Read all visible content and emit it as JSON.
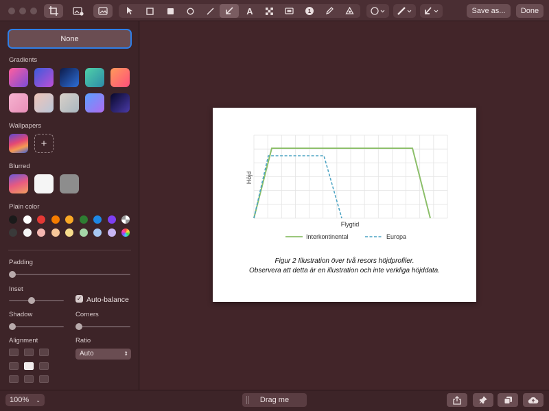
{
  "toolbar": {
    "save_label": "Save as...",
    "done_label": "Done",
    "text_tool_glyph": "A",
    "counter_glyph": "1"
  },
  "sidebar": {
    "none_label": "None",
    "gradients_label": "Gradients",
    "wallpapers_label": "Wallpapers",
    "add_glyph": "+",
    "blurred_label": "Blurred",
    "plain_color_label": "Plain color",
    "padding_label": "Padding",
    "inset_label": "Inset",
    "auto_balance_label": "Auto-balance",
    "auto_balance_checked": true,
    "shadow_label": "Shadow",
    "corners_label": "Corners",
    "alignment_label": "Alignment",
    "ratio_label": "Ratio",
    "ratio_value": "Auto",
    "padding_level": 0,
    "inset_level": 0.4,
    "shadow_level": 0,
    "corners_level": 0,
    "alignment_selected": "center",
    "plain_colors_row1": [
      "#1a1a1a",
      "#ffffff",
      "#e53935",
      "#f57c00",
      "#f9a825",
      "#2e7d32",
      "#1e88e5",
      "#7e3ff2"
    ],
    "plain_colors_row2": [
      "#3a3a3a",
      "#f5f5f5",
      "#f4b6b0",
      "#f7c79a",
      "#f7dc8c",
      "#a5d6a7",
      "#a7c7f2",
      "#c8b5f5"
    ]
  },
  "document": {
    "y_axis_label": "Höjd",
    "x_axis_label": "Flygtid",
    "legend": [
      "Interkontinental",
      "Europa"
    ],
    "caption_line1": "Figur 2 Illustration över två resors höjdprofiler.",
    "caption_line2": "Observera att detta är en illustration och inte verkliga höjddata.",
    "series_colors": {
      "Interkontinental": "#8cbf6a",
      "Europa": "#4ba3c3"
    }
  },
  "bottombar": {
    "zoom_value": "100%",
    "drag_label": "Drag me"
  }
}
